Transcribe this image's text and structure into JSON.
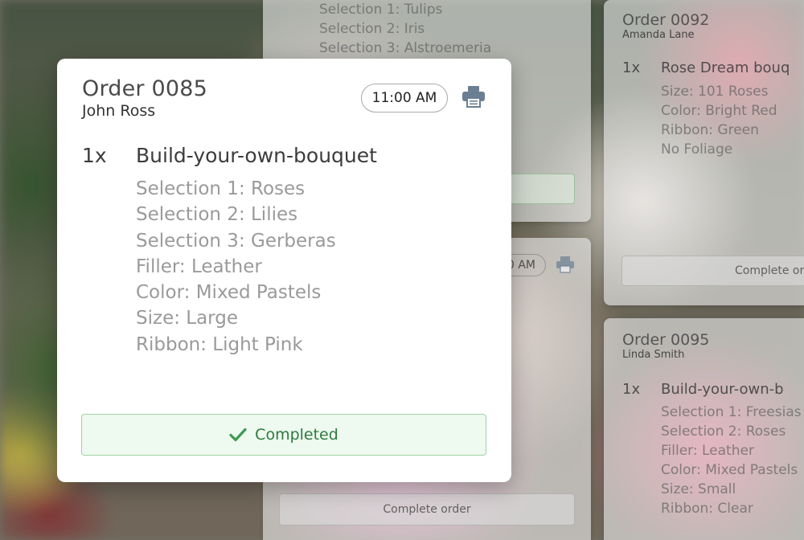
{
  "colors": {
    "card_bg": "#ffffff",
    "title_text": "#4a4a4a",
    "detail_text": "#9a9a9a",
    "completed_green": "#2d7a3e",
    "completed_border": "#9fd3a3",
    "completed_bg": "#eef9ef",
    "printer_icon": "#6b7f92"
  },
  "main_order": {
    "title": "Order 0085",
    "customer": "John Ross",
    "time": "11:00 AM",
    "print_icon": "printer-icon",
    "item": {
      "quantity": "1x",
      "name": "Build-your-own-bouquet",
      "details": [
        "Selection 1: Roses",
        "Selection 2: Lilies",
        "Selection 3: Gerberas",
        "Filler: Leather",
        "Color: Mixed Pastels",
        "Size: Large",
        "Ribbon: Light Pink"
      ]
    },
    "status_button": {
      "icon": "checkmark-icon",
      "label": "Completed"
    }
  },
  "background_orders": {
    "top_center": {
      "details": [
        "Selection 1: Tulips",
        "Selection 2: Iris",
        "Selection 3: Alstroemeria"
      ]
    },
    "mid_center": {
      "time_partial": "0 AM",
      "complete_button": "Complete order"
    },
    "right_top": {
      "title": "Order 0092",
      "customer": "Amanda Lane",
      "quantity": "1x",
      "name": "Rose Dream bouq",
      "details": [
        "Size: 101 Roses",
        "Color: Bright Red",
        "Ribbon: Green",
        "No Foliage"
      ],
      "complete_button": "Complete ord"
    },
    "right_bottom": {
      "title": "Order 0095",
      "customer": "Linda Smith",
      "quantity": "1x",
      "name": "Build-your-own-b",
      "details": [
        "Selection 1: Freesias",
        "Selection 2: Roses",
        "Filler: Leather",
        "Color: Mixed Pastels",
        "Size: Small",
        "Ribbon: Clear"
      ]
    }
  }
}
